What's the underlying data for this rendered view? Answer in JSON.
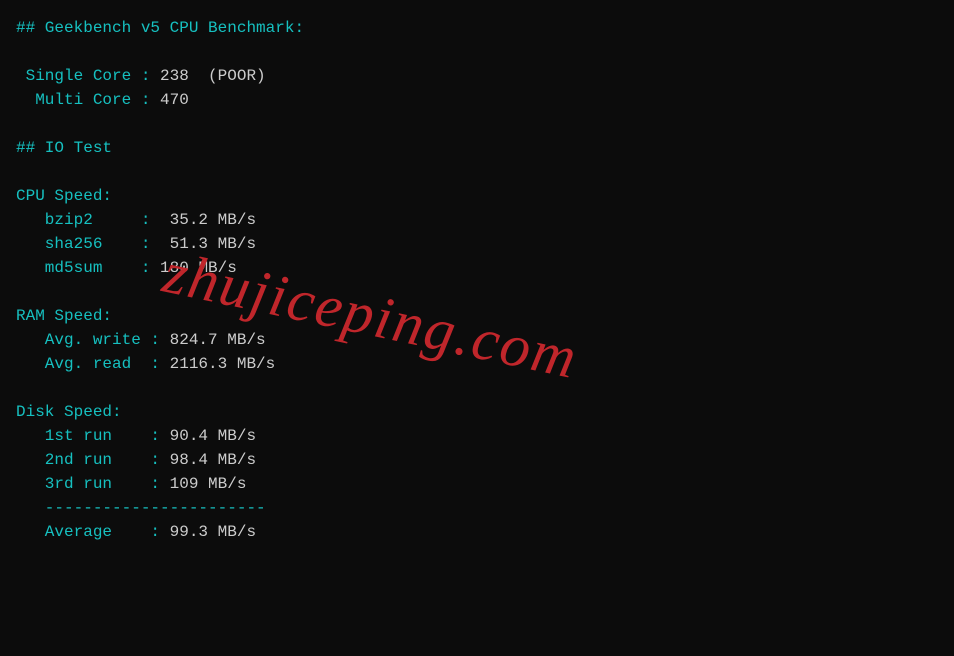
{
  "header": {
    "geekbench_title": "## Geekbench v5 CPU Benchmark:",
    "io_test_title": "## IO Test"
  },
  "geekbench": {
    "single_core_label": " Single Core : ",
    "single_core_value": "238  (POOR)",
    "multi_core_label": "  Multi Core : ",
    "multi_core_value": "470"
  },
  "cpu_speed": {
    "title": "CPU Speed:",
    "bzip2_label": "   bzip2     :  ",
    "bzip2_value": "35.2 MB/s",
    "sha256_label": "   sha256    :  ",
    "sha256_value": "51.3 MB/s",
    "md5sum_label": "   md5sum    : ",
    "md5sum_value": "180 MB/s"
  },
  "ram_speed": {
    "title": "RAM Speed:",
    "write_label": "   Avg. write : ",
    "write_value": "824.7 MB/s",
    "read_label": "   Avg. read  : ",
    "read_value": "2116.3 MB/s"
  },
  "disk_speed": {
    "title": "Disk Speed:",
    "run1_label": "   1st run    : ",
    "run1_value": "90.4 MB/s",
    "run2_label": "   2nd run    : ",
    "run2_value": "98.4 MB/s",
    "run3_label": "   3rd run    : ",
    "run3_value": "109 MB/s",
    "divider": "   -----------------------",
    "avg_label": "   Average    : ",
    "avg_value": "99.3 MB/s"
  },
  "watermark": "zhujiceping.com"
}
